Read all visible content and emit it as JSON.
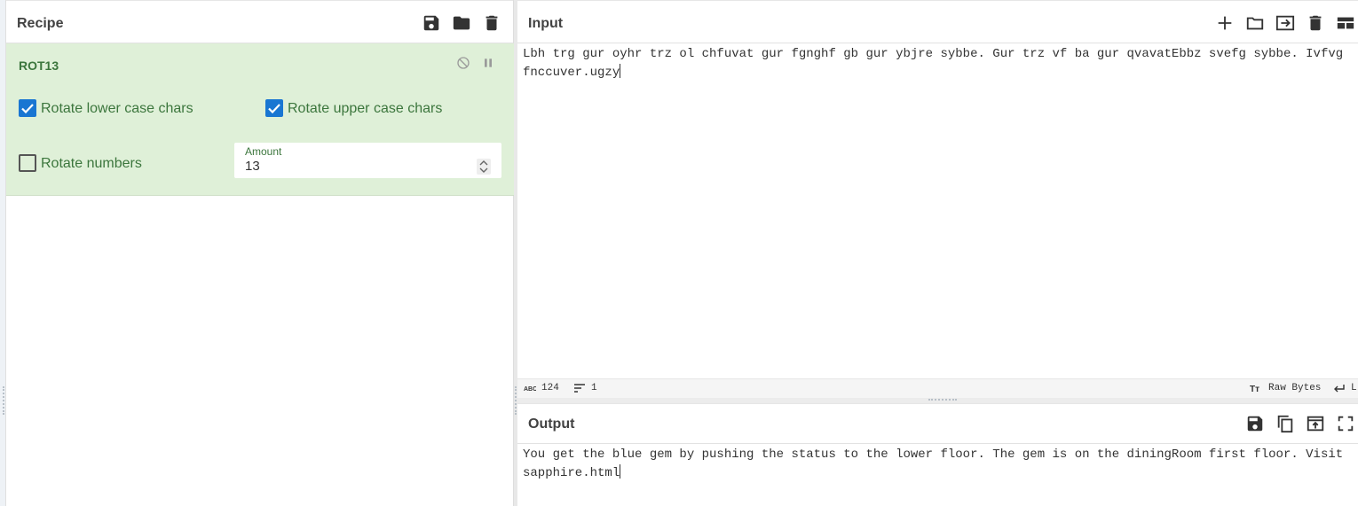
{
  "recipe": {
    "title": "Recipe",
    "operation": {
      "name": "ROT13",
      "rotate_lower_label": "Rotate lower case chars",
      "rotate_lower_checked": true,
      "rotate_upper_label": "Rotate upper case chars",
      "rotate_upper_checked": true,
      "rotate_numbers_label": "Rotate numbers",
      "rotate_numbers_checked": false,
      "amount_label": "Amount",
      "amount_value": "13"
    }
  },
  "input": {
    "title": "Input",
    "text": "Lbh trg gur oyhr trz ol chfuvat gur fgnghf gb gur ybjre sybbe. Gur trz vf ba gur qvavatEbbz svefg sybbe. Ivfvg fnccuver.ugzy",
    "status": {
      "char_count": "124",
      "line_count": "1",
      "encoding": "Raw Bytes",
      "eol": "L"
    }
  },
  "output": {
    "title": "Output",
    "text": "You get the blue gem by pushing the status to the lower floor. The gem is on the diningRoom first floor. Visit sapphire.html"
  },
  "colors": {
    "operation_bg": "#dff0d8",
    "operation_text": "#3c763d",
    "checkbox_on": "#1976d2"
  }
}
